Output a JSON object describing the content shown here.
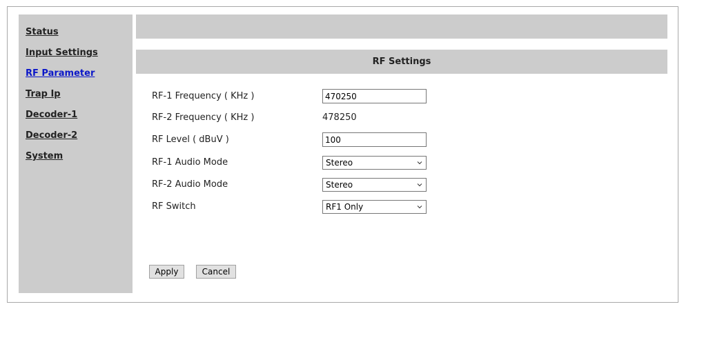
{
  "sidebar": {
    "items": [
      {
        "label": "Status",
        "active": false
      },
      {
        "label": "Input Settings",
        "active": false
      },
      {
        "label": "RF Parameter",
        "active": true
      },
      {
        "label": "Trap Ip",
        "active": false
      },
      {
        "label": "Decoder-1",
        "active": false
      },
      {
        "label": "Decoder-2",
        "active": false
      },
      {
        "label": "System",
        "active": false
      }
    ],
    "active_color": "#0b17c8"
  },
  "main": {
    "section_title": "RF Settings",
    "rows": {
      "rf1_freq": {
        "label": "RF-1 Frequency ( KHz )",
        "value": "470250"
      },
      "rf2_freq": {
        "label": "RF-2 Frequency ( KHz )",
        "value": "478250"
      },
      "rf_level": {
        "label": "RF Level ( dBuV )",
        "value": "100"
      },
      "rf1_audio": {
        "label": "RF-1 Audio Mode",
        "value": "Stereo"
      },
      "rf2_audio": {
        "label": "RF-2 Audio Mode",
        "value": "Stereo"
      },
      "rf_switch": {
        "label": "RF Switch",
        "value": "RF1 Only"
      }
    },
    "buttons": {
      "apply": "Apply",
      "cancel": "Cancel"
    }
  }
}
